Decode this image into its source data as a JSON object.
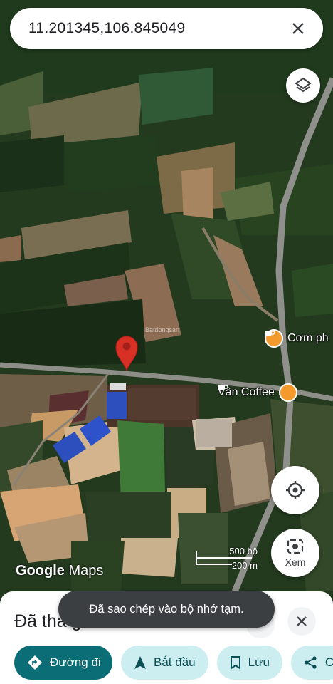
{
  "search": {
    "coordinates": "11.201345,106.845049"
  },
  "map": {
    "pois": [
      {
        "label": "Cơm ph",
        "icon": "coffee-icon"
      },
      {
        "label": "Vân Coffee",
        "icon": "coffee-icon"
      }
    ],
    "watermark": "Batdongsan",
    "scale": {
      "top_label": "500 bộ",
      "bottom_label": "200 m"
    },
    "logo": {
      "google": "Google",
      "maps": "Maps"
    },
    "pin_color": "#d93025"
  },
  "buttons": {
    "layers_icon": "layers-icon",
    "location_icon": "my-location-icon",
    "lens_label": "Xem"
  },
  "sheet": {
    "title": "Đã thả ghim",
    "chips": [
      {
        "label": "Đường đi",
        "icon": "directions-icon"
      },
      {
        "label": "Bắt đầu",
        "icon": "navigation-arrow-icon"
      },
      {
        "label": "Lưu",
        "icon": "bookmark-icon"
      },
      {
        "label": "C",
        "icon": "share-icon"
      }
    ]
  },
  "toast": {
    "message": "Đã sao chép vào bộ nhớ tạm."
  },
  "colors": {
    "accent": "#0b6e77",
    "chip_bg": "#cdeef0",
    "poi": "#f29a2e"
  }
}
